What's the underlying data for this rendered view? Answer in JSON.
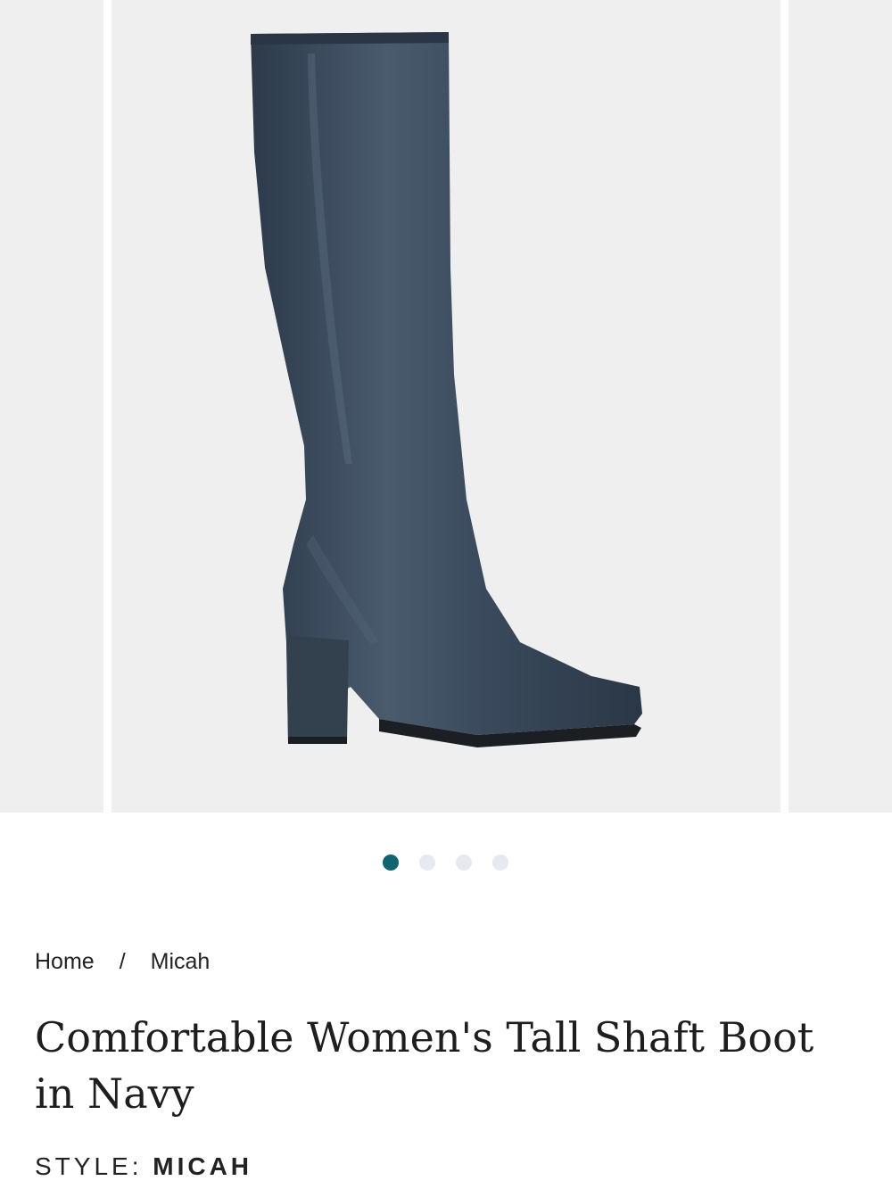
{
  "carousel": {
    "zoom_icon": "search-icon",
    "dot_count": 4,
    "active_dot_index": 0
  },
  "breadcrumb": {
    "home": "Home",
    "separator": "/",
    "current": "Micah"
  },
  "product": {
    "title": "Comfortable Women's Tall Shaft Boot in Navy",
    "style_label": "STYLE:",
    "style_value": "MICAH"
  },
  "colors": {
    "active_dot": "#0f6470",
    "inactive_dot": "#e6e9f0",
    "boot": "#3a4a5c",
    "image_bg": "#efefef"
  }
}
